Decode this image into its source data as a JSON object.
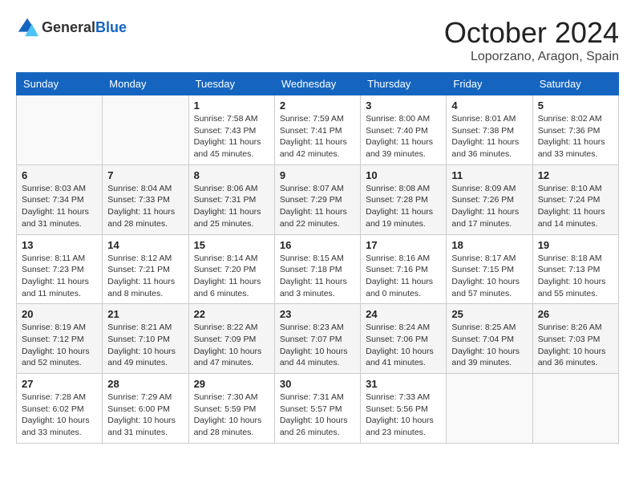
{
  "header": {
    "logo": {
      "general": "General",
      "blue": "Blue"
    },
    "title": "October 2024",
    "location": "Loporzano, Aragon, Spain"
  },
  "weekdays": [
    "Sunday",
    "Monday",
    "Tuesday",
    "Wednesday",
    "Thursday",
    "Friday",
    "Saturday"
  ],
  "weeks": [
    [
      {
        "day": "",
        "info": ""
      },
      {
        "day": "",
        "info": ""
      },
      {
        "day": "1",
        "info": "Sunrise: 7:58 AM\nSunset: 7:43 PM\nDaylight: 11 hours and 45 minutes."
      },
      {
        "day": "2",
        "info": "Sunrise: 7:59 AM\nSunset: 7:41 PM\nDaylight: 11 hours and 42 minutes."
      },
      {
        "day": "3",
        "info": "Sunrise: 8:00 AM\nSunset: 7:40 PM\nDaylight: 11 hours and 39 minutes."
      },
      {
        "day": "4",
        "info": "Sunrise: 8:01 AM\nSunset: 7:38 PM\nDaylight: 11 hours and 36 minutes."
      },
      {
        "day": "5",
        "info": "Sunrise: 8:02 AM\nSunset: 7:36 PM\nDaylight: 11 hours and 33 minutes."
      }
    ],
    [
      {
        "day": "6",
        "info": "Sunrise: 8:03 AM\nSunset: 7:34 PM\nDaylight: 11 hours and 31 minutes."
      },
      {
        "day": "7",
        "info": "Sunrise: 8:04 AM\nSunset: 7:33 PM\nDaylight: 11 hours and 28 minutes."
      },
      {
        "day": "8",
        "info": "Sunrise: 8:06 AM\nSunset: 7:31 PM\nDaylight: 11 hours and 25 minutes."
      },
      {
        "day": "9",
        "info": "Sunrise: 8:07 AM\nSunset: 7:29 PM\nDaylight: 11 hours and 22 minutes."
      },
      {
        "day": "10",
        "info": "Sunrise: 8:08 AM\nSunset: 7:28 PM\nDaylight: 11 hours and 19 minutes."
      },
      {
        "day": "11",
        "info": "Sunrise: 8:09 AM\nSunset: 7:26 PM\nDaylight: 11 hours and 17 minutes."
      },
      {
        "day": "12",
        "info": "Sunrise: 8:10 AM\nSunset: 7:24 PM\nDaylight: 11 hours and 14 minutes."
      }
    ],
    [
      {
        "day": "13",
        "info": "Sunrise: 8:11 AM\nSunset: 7:23 PM\nDaylight: 11 hours and 11 minutes."
      },
      {
        "day": "14",
        "info": "Sunrise: 8:12 AM\nSunset: 7:21 PM\nDaylight: 11 hours and 8 minutes."
      },
      {
        "day": "15",
        "info": "Sunrise: 8:14 AM\nSunset: 7:20 PM\nDaylight: 11 hours and 6 minutes."
      },
      {
        "day": "16",
        "info": "Sunrise: 8:15 AM\nSunset: 7:18 PM\nDaylight: 11 hours and 3 minutes."
      },
      {
        "day": "17",
        "info": "Sunrise: 8:16 AM\nSunset: 7:16 PM\nDaylight: 11 hours and 0 minutes."
      },
      {
        "day": "18",
        "info": "Sunrise: 8:17 AM\nSunset: 7:15 PM\nDaylight: 10 hours and 57 minutes."
      },
      {
        "day": "19",
        "info": "Sunrise: 8:18 AM\nSunset: 7:13 PM\nDaylight: 10 hours and 55 minutes."
      }
    ],
    [
      {
        "day": "20",
        "info": "Sunrise: 8:19 AM\nSunset: 7:12 PM\nDaylight: 10 hours and 52 minutes."
      },
      {
        "day": "21",
        "info": "Sunrise: 8:21 AM\nSunset: 7:10 PM\nDaylight: 10 hours and 49 minutes."
      },
      {
        "day": "22",
        "info": "Sunrise: 8:22 AM\nSunset: 7:09 PM\nDaylight: 10 hours and 47 minutes."
      },
      {
        "day": "23",
        "info": "Sunrise: 8:23 AM\nSunset: 7:07 PM\nDaylight: 10 hours and 44 minutes."
      },
      {
        "day": "24",
        "info": "Sunrise: 8:24 AM\nSunset: 7:06 PM\nDaylight: 10 hours and 41 minutes."
      },
      {
        "day": "25",
        "info": "Sunrise: 8:25 AM\nSunset: 7:04 PM\nDaylight: 10 hours and 39 minutes."
      },
      {
        "day": "26",
        "info": "Sunrise: 8:26 AM\nSunset: 7:03 PM\nDaylight: 10 hours and 36 minutes."
      }
    ],
    [
      {
        "day": "27",
        "info": "Sunrise: 7:28 AM\nSunset: 6:02 PM\nDaylight: 10 hours and 33 minutes."
      },
      {
        "day": "28",
        "info": "Sunrise: 7:29 AM\nSunset: 6:00 PM\nDaylight: 10 hours and 31 minutes."
      },
      {
        "day": "29",
        "info": "Sunrise: 7:30 AM\nSunset: 5:59 PM\nDaylight: 10 hours and 28 minutes."
      },
      {
        "day": "30",
        "info": "Sunrise: 7:31 AM\nSunset: 5:57 PM\nDaylight: 10 hours and 26 minutes."
      },
      {
        "day": "31",
        "info": "Sunrise: 7:33 AM\nSunset: 5:56 PM\nDaylight: 10 hours and 23 minutes."
      },
      {
        "day": "",
        "info": ""
      },
      {
        "day": "",
        "info": ""
      }
    ]
  ]
}
